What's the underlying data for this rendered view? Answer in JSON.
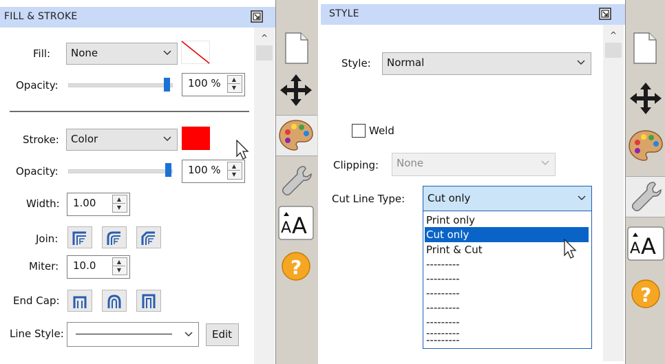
{
  "fill_stroke_panel": {
    "title": "FILL & STROKE",
    "fill_label": "Fill:",
    "fill_value": "None",
    "fill_opacity_label": "Opacity:",
    "fill_opacity_value": "100 %",
    "stroke_label": "Stroke:",
    "stroke_value": "Color",
    "stroke_color": "#ff0000",
    "stroke_opacity_label": "Opacity:",
    "stroke_opacity_value": "100 %",
    "width_label": "Width:",
    "width_value": "1.00",
    "join_label": "Join:",
    "miter_label": "Miter:",
    "miter_value": "10.0",
    "endcap_label": "End Cap:",
    "linestyle_label": "Line Style:",
    "edit_label": "Edit"
  },
  "style_panel": {
    "title": "STYLE",
    "style_label": "Style:",
    "style_value": "Normal",
    "weld_label": "Weld",
    "clipping_label": "Clipping:",
    "clipping_value": "None",
    "cut_line_type_label": "Cut Line Type:",
    "cut_line_type_value": "Cut only",
    "options": [
      "Print only",
      "Cut only",
      "Print & Cut",
      "---------",
      "---------",
      "---------",
      "---------",
      "---------",
      "---------",
      "---------"
    ],
    "selected_option": "Cut only"
  },
  "sidebar_tabs": [
    "document-icon",
    "move-icon",
    "palette-icon",
    "wrench-icon",
    "text-size-icon",
    "help-icon"
  ],
  "colors": {
    "header_bg": "#c9daf8",
    "accent": "#1a72d6",
    "sidebar_bg": "#d4d0c8"
  }
}
